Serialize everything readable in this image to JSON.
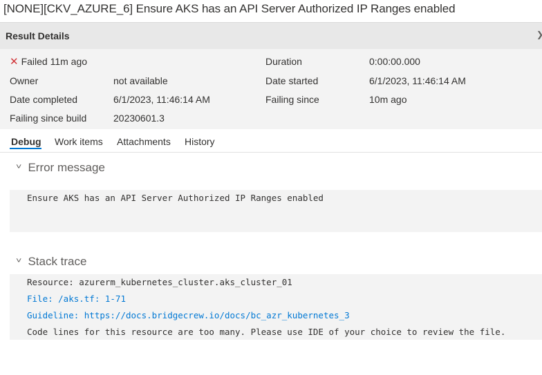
{
  "title": "[NONE][CKV_AZURE_6] Ensure AKS has an API Server Authorized IP Ranges enabled",
  "result_details": {
    "header": "Result Details",
    "status": "Failed 11m ago",
    "owner_label": "Owner",
    "owner_value": "not available",
    "date_completed_label": "Date completed",
    "date_completed_value": "6/1/2023, 11:46:14 AM",
    "failing_since_build_label": "Failing since build",
    "failing_since_build_value": "20230601.3",
    "duration_label": "Duration",
    "duration_value": "0:00:00.000",
    "date_started_label": "Date started",
    "date_started_value": "6/1/2023, 11:46:14 AM",
    "failing_since_label": "Failing since",
    "failing_since_value": "10m ago"
  },
  "tabs": [
    {
      "label": "Debug",
      "active": true
    },
    {
      "label": "Work items"
    },
    {
      "label": "Attachments"
    },
    {
      "label": "History"
    }
  ],
  "error_section": {
    "title": "Error message",
    "message": "Ensure AKS has an API Server Authorized IP Ranges enabled"
  },
  "stack_section": {
    "title": "Stack trace",
    "lines": [
      "Resource: azurerm_kubernetes_cluster.aks_cluster_01",
      "File: /aks.tf: 1-71",
      "Guideline: https://docs.bridgecrew.io/docs/bc_azr_kubernetes_3",
      "Code lines for this resource are too many. Please use IDE of your choice to review the file."
    ]
  },
  "colors": {
    "accent": "#0078d4",
    "failed": "#d13438",
    "panel": "#f3f3f3"
  }
}
